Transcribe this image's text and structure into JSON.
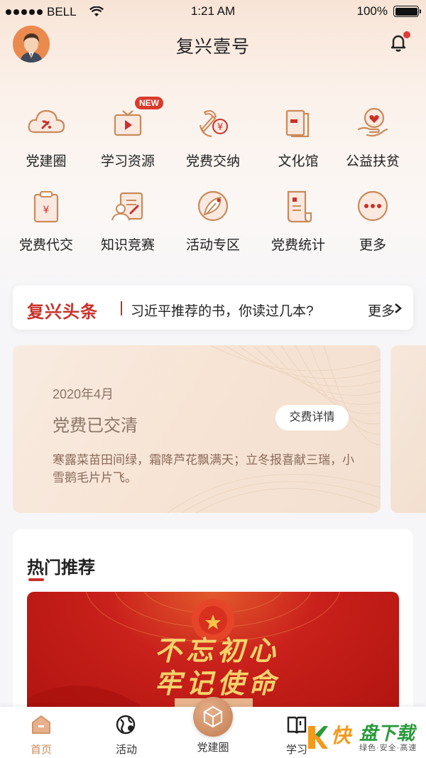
{
  "status_bar": {
    "carrier": "BELL",
    "time": "1:21 AM",
    "battery": "100%"
  },
  "header": {
    "title": "复兴壹号"
  },
  "grid": [
    {
      "label": "党建圈",
      "icon": "cloud-party-icon"
    },
    {
      "label": "学习资源",
      "icon": "video-play-icon",
      "badge": "NEW"
    },
    {
      "label": "党费交纳",
      "icon": "party-emblem-yuan-icon"
    },
    {
      "label": "文化馆",
      "icon": "book-icon"
    },
    {
      "label": "公益扶贫",
      "icon": "heart-hand-icon"
    },
    {
      "label": "党费代交",
      "icon": "clipboard-yuan-icon"
    },
    {
      "label": "知识竞赛",
      "icon": "person-quiz-icon"
    },
    {
      "label": "活动专区",
      "icon": "leaf-circle-icon"
    },
    {
      "label": "党费统计",
      "icon": "receipt-icon"
    },
    {
      "label": "更多",
      "icon": "more-icon"
    }
  ],
  "headline": {
    "brand": "复兴头条",
    "text": "习近平推荐的书，你读过几本?",
    "more": "更多"
  },
  "fee_card": {
    "date": "2020年4月",
    "status": "党费已交清",
    "button": "交费详情",
    "poem": "寒露菜苗田间绿，霜降芦花飘满天；立冬报喜献三瑞，小雪鹅毛片片飞。"
  },
  "hot": {
    "title": "热门推荐",
    "banner_text": "不忘初心 牢记使命"
  },
  "tabbar": [
    {
      "label": "首页",
      "icon": "home-icon",
      "active": true
    },
    {
      "label": "活动",
      "icon": "globe-pin-icon"
    },
    {
      "label": "党建圈",
      "icon": "cube-icon"
    },
    {
      "label": "学习",
      "icon": "open-book-icon"
    }
  ],
  "watermark": {
    "main_a": "快",
    "main_b": "盘下载",
    "sub": "绿色·安全·高速"
  },
  "colors": {
    "accent": "#c9312a",
    "icon_stroke": "#c98a5a",
    "tab_active": "#c98a5a"
  }
}
